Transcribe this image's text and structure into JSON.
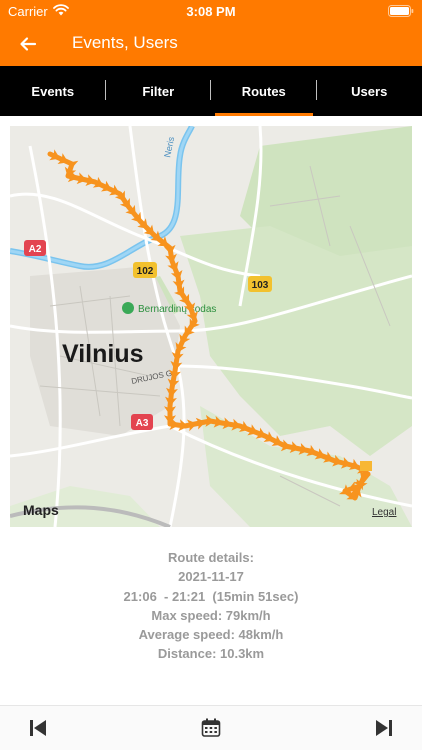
{
  "status": {
    "carrier": "Carrier",
    "time": "3:08 PM"
  },
  "nav": {
    "title": "Events, Users",
    "back_icon": "arrow-left-icon"
  },
  "tabs": [
    {
      "label": "Events",
      "active": false
    },
    {
      "label": "Filter",
      "active": false
    },
    {
      "label": "Routes",
      "active": true
    },
    {
      "label": "Users",
      "active": false
    }
  ],
  "map": {
    "city_label": "Vilnius",
    "poi_label": "Bernardinų sodas",
    "river_label": "Neris",
    "street_label": "DRUJOS G.",
    "road_shields": [
      "A2",
      "102",
      "103",
      "A3"
    ],
    "attribution": "Maps",
    "legal": "Legal",
    "route_color": "#f7931e"
  },
  "route_details": {
    "heading": "Route details:",
    "date": "2021-11-17",
    "time_range": "21:06  - 21:21  (15min 51sec)",
    "max_speed": "Max speed: 79km/h",
    "avg_speed": "Average speed: 48km/h",
    "distance": "Distance: 10.3km"
  },
  "bottom": {
    "prev_icon": "skip-back-icon",
    "calendar_icon": "calendar-icon",
    "next_icon": "skip-forward-icon"
  },
  "colors": {
    "accent": "#ff7a00",
    "tab_bar": "#000000",
    "details_text": "#9a9a9a"
  }
}
